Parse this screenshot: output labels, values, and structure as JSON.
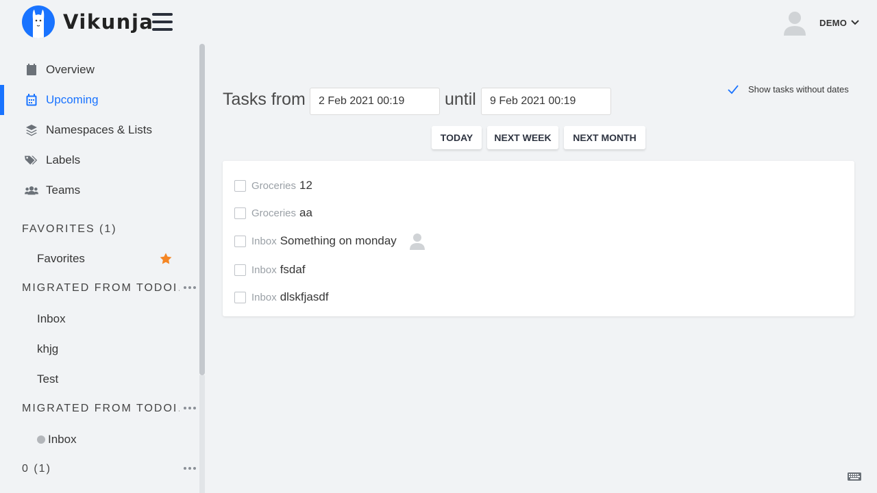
{
  "app": {
    "name": "Vikunja"
  },
  "user": {
    "name": "DEMO"
  },
  "nav": [
    {
      "label": "Overview",
      "icon": "calendar-icon"
    },
    {
      "label": "Upcoming",
      "icon": "calendar-week-icon",
      "active": true
    },
    {
      "label": "Namespaces & Lists",
      "icon": "layers-icon"
    },
    {
      "label": "Labels",
      "icon": "tags-icon"
    },
    {
      "label": "Teams",
      "icon": "users-icon"
    }
  ],
  "namespaces": [
    {
      "title": "FAVORITES (1)",
      "lists": [
        {
          "label": "Favorites"
        }
      ]
    },
    {
      "title": "MIGRATED FROM TODOI…",
      "lists": [
        {
          "label": "Inbox"
        },
        {
          "label": "khjg"
        },
        {
          "label": "Test"
        }
      ]
    },
    {
      "title": "MIGRATED FROM TODOI…",
      "lists": [
        {
          "label": "Inbox"
        }
      ]
    },
    {
      "title": "0 (1)",
      "lists": []
    }
  ],
  "main": {
    "tasks_from_label": "Tasks from",
    "from_date": "2 Feb 2021 00:19",
    "until_label": "until",
    "until_date": "9 Feb 2021 00:19",
    "show_without_dates": "Show tasks without dates",
    "buttons": {
      "today": "TODAY",
      "next_week": "NEXT WEEK",
      "next_month": "NEXT MONTH"
    },
    "tasks": [
      {
        "list": "Groceries",
        "title": "12"
      },
      {
        "list": "Groceries",
        "title": "aa"
      },
      {
        "list": "Inbox",
        "title": "Something on monday",
        "assignee": true
      },
      {
        "list": "Inbox",
        "title": "fsdaf"
      },
      {
        "list": "Inbox",
        "title": "dlskfjasdf"
      }
    ]
  },
  "colors": {
    "primary": "#1973ff",
    "favorite_star": "#f58624",
    "background": "#f1f3f5"
  }
}
